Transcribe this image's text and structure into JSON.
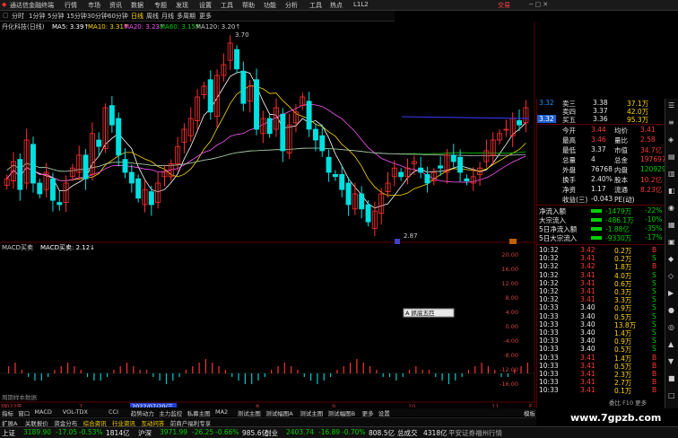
{
  "menu": {
    "items": [
      "通达信金融终端",
      "行情",
      "市场",
      "资讯",
      "数据",
      "专题",
      "发现",
      "设置",
      "工具",
      "帮助",
      "功能",
      "分析",
      "资讯",
      "工具",
      "热点",
      "L1L2"
    ],
    "trade": "交易"
  },
  "periods": [
    "分时",
    "1分钟",
    "5分钟",
    "15分钟",
    "30分钟",
    "60分钟",
    "日线",
    "周线",
    "月线",
    "多周期",
    "更多"
  ],
  "stock": {
    "name": "丹化科技(日线)",
    "ma_labels": [
      {
        "text": "MA5: 3.39↑",
        "color": "#ffffff"
      },
      {
        "text": "MA10: 3.31↑",
        "color": "#ffd700"
      },
      {
        "text": "MA20: 3.23↑",
        "color": "#ff55ff"
      },
      {
        "text": "MA60: 3.15↑",
        "color": "#00d000"
      },
      {
        "text": "MA120: 3.20↑",
        "color": "#cccccc"
      }
    ],
    "high_mark": "3.70",
    "low_mark": "2.87",
    "price_label": "3.32",
    "candles": [
      3.07,
      3.15,
      3.02,
      3.25,
      3.05,
      3.0,
      3.1,
      2.97,
      2.95,
      3.05,
      3.12,
      3.18,
      3.07,
      3.28,
      3.22,
      3.4,
      3.32,
      3.18,
      3.1,
      3.05,
      2.98,
      3.02,
      2.95,
      3.05,
      3.1,
      3.14,
      3.22,
      3.3,
      3.35,
      3.45,
      3.5,
      3.38,
      3.55,
      3.6,
      3.7,
      3.58,
      3.42,
      3.5,
      3.3,
      3.35,
      3.28,
      3.4,
      3.2,
      3.32,
      3.38,
      3.45,
      3.3,
      3.25,
      3.2,
      3.1,
      3.08,
      3.02,
      2.95,
      3.0,
      2.93,
      2.87,
      2.92,
      3.0,
      3.05,
      3.12,
      3.08,
      3.12,
      3.15,
      3.1,
      3.05,
      3.1,
      3.12,
      3.18,
      3.15,
      3.1,
      3.06,
      3.08,
      3.12,
      3.2,
      3.25,
      3.28,
      3.3,
      3.35,
      3.32,
      3.4
    ]
  },
  "price_axis": [
    "3.40",
    "3.35",
    "3.30",
    "3.25",
    "3.20",
    "3.15",
    "3.10",
    "3.05",
    "3.00",
    "2.95",
    "2.90",
    "2.85"
  ],
  "macd": {
    "title": "MACD买卖",
    "sub": "MACD买卖: 2.12↓",
    "axis": [
      "20.00",
      "16.00",
      "12.00",
      "8.00",
      "4.00",
      "0.00",
      "-4.00",
      "-8.00",
      "-12.00",
      "-16.00"
    ],
    "popup": "A 抓底五匹",
    "hint": "周期样本数据",
    "bars": [
      2,
      3,
      1,
      -1,
      -2,
      -2,
      -1,
      1,
      2,
      3,
      2,
      1,
      -1,
      -2,
      -2,
      -1,
      1,
      2,
      3,
      2,
      1,
      1,
      -1,
      -2,
      -3,
      -2,
      -1,
      1,
      2,
      3,
      4,
      3,
      2,
      1,
      -1,
      -2,
      -3,
      -3,
      -2,
      -1,
      1,
      2,
      3,
      2,
      1,
      -1,
      -2,
      -3,
      -2,
      -1,
      1,
      2,
      3,
      4,
      3,
      2,
      1,
      -1,
      -1,
      -2,
      -1,
      1,
      2,
      1,
      1,
      -1,
      -2,
      -3,
      -2,
      -1,
      1,
      2,
      3,
      2,
      1,
      -1,
      -1,
      1,
      2,
      3
    ]
  },
  "date_axis": {
    "labels": [
      "2022年",
      "7",
      "2022/07/20/三",
      "8",
      "9",
      "10",
      "11",
      "12"
    ],
    "right": "E"
  },
  "quote": {
    "rows": [
      {
        "k": "卖三",
        "p": "3.38",
        "v": "37.1万",
        "pc": "#e0e0e0",
        "vc": "#ffd700"
      },
      {
        "k": "卖四",
        "p": "3.37",
        "v": "42.0万",
        "pc": "#e0e0e0",
        "vc": "#ffd700"
      },
      {
        "k": "买五",
        "p": "3.36",
        "v": "95.3万",
        "pc": "#e0e0e0",
        "vc": "#ffd700"
      }
    ],
    "stats": [
      {
        "a": "今开",
        "av": "3.44",
        "b": "均价",
        "bv": "3.41"
      },
      {
        "a": "最高",
        "av": "3.46",
        "b": "量比",
        "bv": "2.58"
      },
      {
        "a": "最低",
        "av": "3.37",
        "b": "市值",
        "bv": "34.7亿"
      },
      {
        "a": "总量",
        "av": "4",
        "b": "总金",
        "bv": "197697"
      },
      {
        "a": "外盘",
        "av": "76768",
        "b": "内盘",
        "bv": "120929"
      },
      {
        "a": "换手",
        "av": "2.40%",
        "b": "股本",
        "bv": "10.2亿"
      },
      {
        "a": "净资",
        "av": "1.17",
        "b": "流通",
        "bv": "8.23亿"
      },
      {
        "a": "收益(三)",
        "av": "-0.043",
        "b": "PE(动)",
        "bv": ""
      }
    ],
    "flows": [
      {
        "k": "净流入额",
        "v": "-1479万",
        "p": "-22%"
      },
      {
        "k": "大宗流入",
        "v": "-486.1万",
        "p": "-10%"
      },
      {
        "k": "5日净流入额",
        "v": "-1.88亿",
        "p": "-35%"
      },
      {
        "k": "5日大宗流入",
        "v": "-9330万",
        "p": "-17%"
      }
    ],
    "ticks": [
      {
        "t": "10:32",
        "p": "3.42",
        "v": "0.2万",
        "d": "B"
      },
      {
        "t": "10:32",
        "p": "3.41",
        "v": "0.2万",
        "d": "S"
      },
      {
        "t": "10:32",
        "p": "3.42",
        "v": "1.8万",
        "d": "B"
      },
      {
        "t": "10:32",
        "p": "3.41",
        "v": "4.0万",
        "d": "S"
      },
      {
        "t": "10:32",
        "p": "3.41",
        "v": "0.6万",
        "d": "S"
      },
      {
        "t": "10:32",
        "p": "3.41",
        "v": "0.3万",
        "d": "S"
      },
      {
        "t": "10:32",
        "p": "3.41",
        "v": "3.3万",
        "d": "S"
      },
      {
        "t": "10:33",
        "p": "3.40",
        "v": "0.9万",
        "d": "S"
      },
      {
        "t": "10:33",
        "p": "3.40",
        "v": "0.5万",
        "d": "S"
      },
      {
        "t": "10:33",
        "p": "3.40",
        "v": "13.8万",
        "d": "S"
      },
      {
        "t": "10:33",
        "p": "3.40",
        "v": "1.4万",
        "d": "S"
      },
      {
        "t": "10:33",
        "p": "3.40",
        "v": "0.9万",
        "d": "S"
      },
      {
        "t": "10:33",
        "p": "3.40",
        "v": "0.5万",
        "d": "S"
      },
      {
        "t": "10:33",
        "p": "3.41",
        "v": "1.4万",
        "d": "B"
      },
      {
        "t": "10:33",
        "p": "3.41",
        "v": "0.5万",
        "d": "B"
      },
      {
        "t": "10:33",
        "p": "3.41",
        "v": "2.3万",
        "d": "B"
      },
      {
        "t": "10:33",
        "p": "3.41",
        "v": "2.7万",
        "d": "B"
      },
      {
        "t": "10:33",
        "p": "3.41",
        "v": "0.1万",
        "d": "B"
      }
    ],
    "bottom": "委比 F10 更多"
  },
  "sidebar_icons": [
    "☰",
    "≡",
    "◈",
    "▤",
    "▥",
    "◧",
    "◉",
    "▦",
    "▣",
    "◆",
    "◇",
    "▶",
    "●",
    "◎",
    "▲",
    "▼",
    "■",
    "□"
  ],
  "bottom_tabs": [
    "指标",
    "窗口",
    "MACD",
    "VOL-TDX",
    "CCI",
    "趋势动力",
    "主力监控",
    "私募主图",
    "MA2",
    "测试主图",
    "测试幅图A",
    "测试主图",
    "测试幅图B",
    "更多",
    "设置"
  ],
  "bottom_right": "模板",
  "tabs2": [
    "扩展A",
    "关联报价",
    "资金分布",
    "综合资讯",
    "行业资讯",
    "互动问答",
    "前商户福利专享"
  ],
  "status": [
    {
      "label": "上证",
      "v": "3189.90",
      "c": "-17.05",
      "p": "-0.53%",
      "amt": "1814亿"
    },
    {
      "label": "沪深",
      "v": "3971.99",
      "c": "-26.25",
      "p": "-0.66%",
      "amt": "985.6亿"
    },
    {
      "label": "创业",
      "v": "2403.74",
      "c": "-16.89",
      "p": "-0.70%",
      "amt": "808.5亿"
    }
  ],
  "status_extra": {
    "label": "总成交",
    "amt": "4318亿",
    "tail": "平安证券福州行情"
  },
  "watermark": "www.7gpzb.com"
}
